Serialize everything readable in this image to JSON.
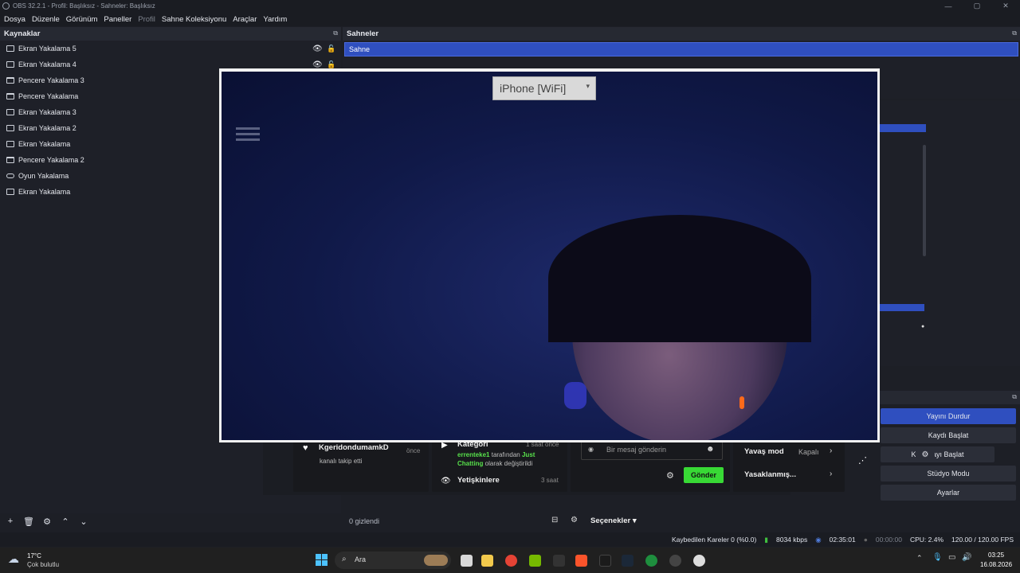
{
  "window": {
    "title": "OBS 32.2.1 - Profil: Başlıksız - Sahneler: Başlıksız"
  },
  "menu": [
    "Dosya",
    "Düzenle",
    "Görünüm",
    "Paneller",
    "Profil",
    "Sahne Koleksiyonu",
    "Araçlar",
    "Yardım"
  ],
  "sources": {
    "title": "Kaynaklar",
    "items": [
      {
        "label": "Ekran Yakalama 5",
        "type": "display"
      },
      {
        "label": "Ekran Yakalama 4",
        "type": "display"
      },
      {
        "label": "Pencere Yakalama 3",
        "type": "window"
      },
      {
        "label": "Pencere Yakalama",
        "type": "window"
      },
      {
        "label": "Ekran Yakalama 3",
        "type": "display"
      },
      {
        "label": "Ekran Yakalama 2",
        "type": "display"
      },
      {
        "label": "Ekran Yakalama",
        "type": "display"
      },
      {
        "label": "Pencere Yakalama 2",
        "type": "window"
      },
      {
        "label": "Oyun Yakalama",
        "type": "game"
      },
      {
        "label": "Ekran Yakalama",
        "type": "display"
      }
    ]
  },
  "scenes": {
    "title": "Sahneler",
    "items": [
      "Sahne"
    ]
  },
  "preview": {
    "camera_dropdown": "iPhone [WiFi]"
  },
  "chat": {
    "follower_name": "KgeridondumamkD",
    "follower_action": "kanalı takip etti",
    "follower_time": "önce",
    "category_title": "Kategori",
    "category_time": "1 saat önce",
    "category_user": "errenteke1",
    "category_mid": "tarafından",
    "category_value": "Just Chatting",
    "category_end": "olarak değiştirildi",
    "adults_title": "Yetişkinlere",
    "adults_time": "3 saat",
    "message_placeholder": "Bir mesaj gönderin",
    "send_label": "Gönder",
    "slow_mode": "Yavaş mod",
    "slow_mode_value": "Kapalı",
    "banned": "Yasaklanmış..."
  },
  "mixer": {
    "hidden": "0 gizlendi",
    "options": "Seçenekler"
  },
  "controls": {
    "stop_stream": "Yayını Durdur",
    "start_record": "Kaydı Başlat",
    "start_camera": "Kamerayı Başlat",
    "studio_mode": "Stüdyo Modu",
    "settings": "Ayarlar"
  },
  "status": {
    "dropped": "Kaybedilen Kareler 0 (%0.0)",
    "bitrate": "8034 kbps",
    "live_time": "02:35:01",
    "rec_time": "00:00:00",
    "cpu": "CPU: 2.4%",
    "fps": "120.00 / 120.00 FPS"
  },
  "taskbar": {
    "weather_temp": "17°C",
    "weather_desc": "Çok bulutlu",
    "search": "Ara",
    "clock_time": "03:25",
    "clock_date": "16.08.2026"
  },
  "colors": {
    "accent": "#2f4fbf",
    "send_green": "#38d935",
    "bg": "#1d1f26"
  }
}
